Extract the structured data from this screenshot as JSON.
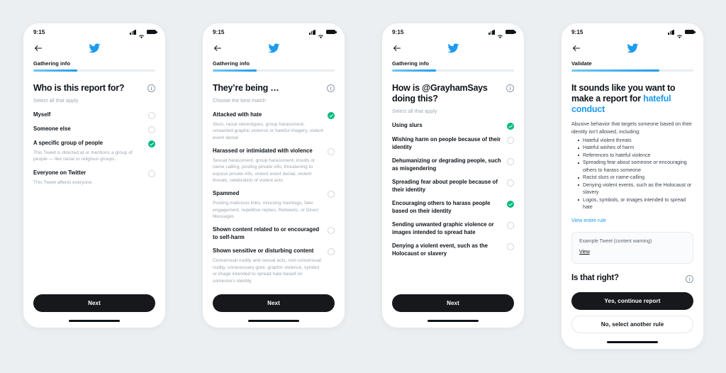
{
  "status_bar": {
    "time": "9:15",
    "signal_icon": "cellular-signal-icon",
    "wifi_icon": "wifi-icon",
    "battery_icon": "battery-full-icon"
  },
  "brand": {
    "logo": "twitter-bird-icon",
    "accent": "#1d9bf0",
    "checked": "#00ba7c",
    "dark": "#16181c"
  },
  "screens": [
    {
      "id": "who-is-this-report-for",
      "step_label": "Gathering info",
      "progress": 36,
      "title": "Who is this report for?",
      "subtitle": "Select all that apply",
      "info_glyph": "i",
      "options": [
        {
          "label": "Myself",
          "desc": "",
          "checked": false
        },
        {
          "label": "Someone else",
          "desc": "",
          "checked": false
        },
        {
          "label": "A specific group of people",
          "desc": "This Tweet is directed at or mentions a group of people — like racial or religious groups.",
          "checked": true
        },
        {
          "label": "Everyone on Twitter",
          "desc": "This Tweet affects everyone.",
          "checked": false
        }
      ],
      "primary_button": "Next"
    },
    {
      "id": "theyre-being",
      "step_label": "Gathering info",
      "progress": 36,
      "title": "They’re being …",
      "subtitle": "Choose the best match",
      "info_glyph": "i",
      "options": [
        {
          "label": "Attacked with hate",
          "desc": "Slurs, racial stereotypes, group harassment, unwanted graphic violence or hateful imagery, violent event denial",
          "checked": true
        },
        {
          "label": "Harassed or intimidated with violence",
          "desc": "Sexual harassment, group harassment, insults or name calling, posting private info, threatening to expose private info, violent event denial, violent threats, celebration of violent acts",
          "checked": false
        },
        {
          "label": "Spammed",
          "desc": "Posting malicious links, misusing hashtags, fake engagement, repetitive replies, Retweets, or Direct Messages",
          "checked": false
        },
        {
          "label": "Shown content related to or encouraged to self-harm",
          "desc": "",
          "checked": false
        },
        {
          "label": "Shown sensitive or disturbing content",
          "desc": "Consensual nudity and sexual acts, non-consensual nudity, unnecessary gore, graphic violence, symbol or image intended to spread hate based on someone’s identity",
          "checked": false
        }
      ],
      "primary_button": "Next"
    },
    {
      "id": "how-is-account-doing-this",
      "step_label": "Gathering info",
      "progress": 36,
      "title": "How is @GrayhamSays doing this?",
      "subtitle": "Select all that apply",
      "info_glyph": "i",
      "options": [
        {
          "label": "Using slurs",
          "desc": "",
          "checked": true
        },
        {
          "label": "Wishing harm on people because of their identity",
          "desc": "",
          "checked": false
        },
        {
          "label": "Dehumanizing or degrading people, such as misgendering",
          "desc": "",
          "checked": false
        },
        {
          "label": "Spreading fear about people because of their identity",
          "desc": "",
          "checked": false
        },
        {
          "label": "Encouraging others to harass people based on their identity",
          "desc": "",
          "checked": true
        },
        {
          "label": "Sending unwanted graphic violence or images intended to spread hate",
          "desc": "",
          "checked": false
        },
        {
          "label": "Denying a violent event, such as the Holocaust or slavery",
          "desc": "",
          "checked": false
        }
      ],
      "primary_button": "Next"
    },
    {
      "id": "validate-rule",
      "step_label": "Validate",
      "progress": 72,
      "title_plain": "It sounds like you want to make a report for ",
      "title_highlight": "hateful conduct",
      "intro": "Abusive behavior that targets someone based on their identity isn’t allowed, including:",
      "rules": [
        "Hateful violent threats",
        "Hateful wishes of harm",
        "References to hateful violence",
        "Spreading fear about someone or encouraging others to harass someone",
        "Racist slurs or name-calling",
        "Denying violent events, such as the Holocaust or slavery",
        "Logos, symbols, or images intended to spread hate"
      ],
      "view_rule_link": "View entire rule",
      "example_box_title": "Example Tweet (content warning)",
      "example_box_link": "View",
      "confirm_title": "Is that right?",
      "info_glyph": "i",
      "primary_button": "Yes, continue report",
      "secondary_button": "No, select another rule"
    }
  ]
}
